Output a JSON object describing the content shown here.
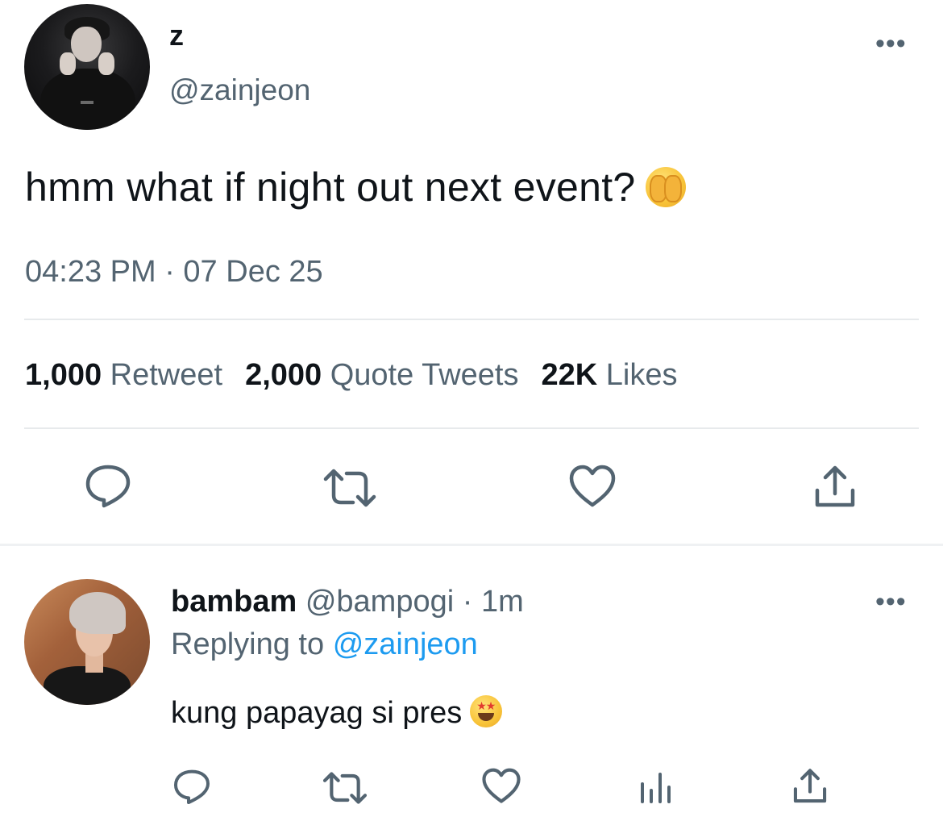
{
  "tweet": {
    "display_name": "z",
    "handle": "@zainjeon",
    "more_label": "•••",
    "text": "hmm what if night out next event?",
    "emoji": "see-no-evil-peek-emoji",
    "timestamp": "04:23 PM · 07 Dec 25",
    "stats": {
      "retweets_count": "1,000",
      "retweets_label": "Retweet",
      "quotes_count": "2,000",
      "quotes_label": "Quote Tweets",
      "likes_count": "22K",
      "likes_label": "Likes"
    },
    "actions": [
      "reply-icon",
      "retweet-icon",
      "like-icon",
      "share-icon"
    ]
  },
  "reply": {
    "display_name": "bambam",
    "handle": "@bampogi",
    "time": "· 1m",
    "more_label": "•••",
    "replying_prefix": "Replying to",
    "replying_to": "@zainjeon",
    "text": "kung papayag si pres",
    "emoji": "star-struck-emoji",
    "actions": [
      "reply-icon",
      "retweet-icon",
      "like-icon",
      "analytics-icon",
      "share-icon"
    ]
  },
  "colors": {
    "text": "#0f1419",
    "secondary": "#536471",
    "link": "#1d9bf0",
    "divider": "#e7eaec"
  }
}
